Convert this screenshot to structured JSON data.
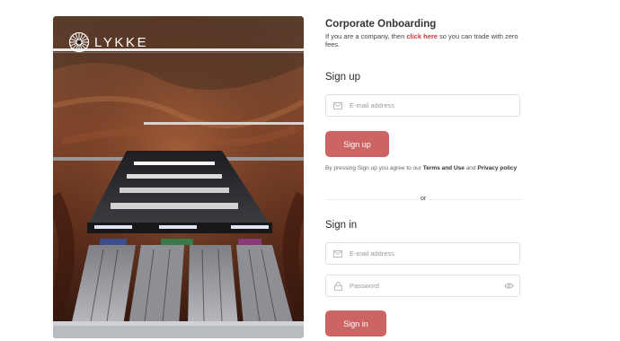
{
  "brand": {
    "name": "LYKKE"
  },
  "onboarding": {
    "title": "Corporate Onboarding",
    "text_before": "If you are a company, then ",
    "link_text": "click here",
    "text_after": " so you can trade with zero fees."
  },
  "signup": {
    "title": "Sign up",
    "email_placeholder": "E-mail address",
    "button_label": "Sign up",
    "terms_before": "By pressing Sign up you agree to our ",
    "terms_link": "Terms and Use",
    "terms_middle": " and ",
    "privacy_link": "Privacy policy"
  },
  "divider_text": "or",
  "signin": {
    "title": "Sign in",
    "email_placeholder": "E-mail address",
    "password_placeholder": "Password",
    "button_label": "Sign in"
  },
  "colors": {
    "accent": "#cc6463",
    "link": "#c3383f"
  },
  "icons": [
    "lykke-logo-icon",
    "envelope-icon",
    "lock-icon",
    "eye-icon"
  ]
}
